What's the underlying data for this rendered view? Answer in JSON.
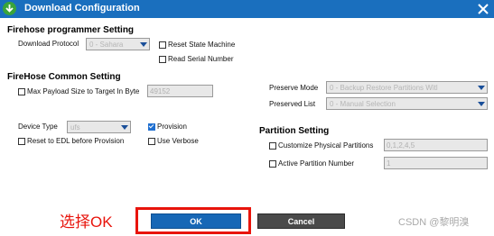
{
  "window": {
    "title": "Download Configuration",
    "icon": "download-arrow-icon",
    "close_icon": "close-icon",
    "title_bar_color": "#1a6fbe"
  },
  "programmer_setting": {
    "heading": "Firehose programmer Setting",
    "download_protocol_label": "Download Protocol",
    "download_protocol_value": "0 - Sahara",
    "reset_state_machine_label": "Reset State Machine",
    "read_serial_number_label": "Read Serial Number"
  },
  "common_setting": {
    "heading": "FireHose Common Setting",
    "max_payload_label": "Max Payload Size to Target In Byte",
    "max_payload_value": "49152",
    "device_type_label": "Device Type",
    "device_type_value": "ufs",
    "provision_label": "Provision",
    "provision_checked": true,
    "reset_edl_label": "Reset to EDL before Provision",
    "use_verbose_label": "Use Verbose"
  },
  "preserve": {
    "mode_label": "Preserve Mode",
    "mode_value": "0 - Backup Restore Partitions Witl",
    "list_label": "Preserved List",
    "list_value": "0 - Manual Selection"
  },
  "partition_setting": {
    "heading": "Partition Setting",
    "customize_label": "Customize Physical Partitions",
    "customize_value": "0,1,2,4,5",
    "active_label": "Active Partition Number",
    "active_value": "1"
  },
  "buttons": {
    "ok_label": "OK",
    "cancel_label": "Cancel",
    "ok_color": "#1767b6",
    "cancel_color": "#4a4a4a"
  },
  "annotation": {
    "text": "选择OK",
    "color": "#e8140c"
  },
  "watermark": {
    "text": "CSDN @黎明溴"
  }
}
